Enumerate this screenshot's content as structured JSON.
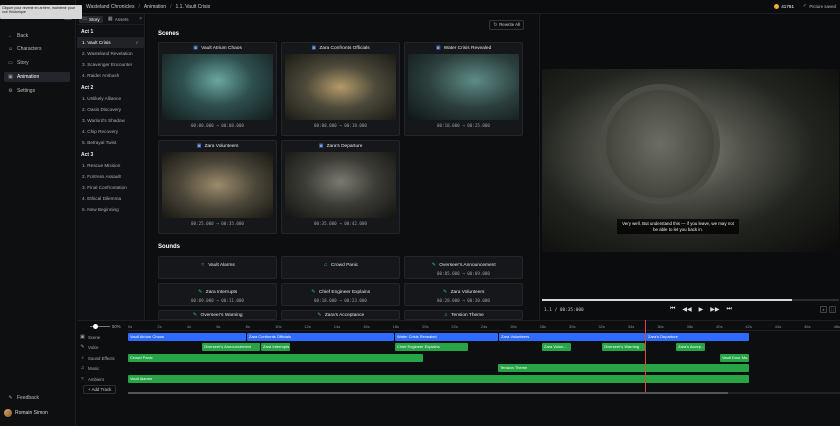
{
  "tooltip": "Cliquer pour revenir en arrière, maintenir pour voir l'historique",
  "nav": {
    "items": [
      {
        "label": "Back",
        "icon": "arrow-left-icon"
      },
      {
        "label": "Characters",
        "icon": "users-icon"
      },
      {
        "label": "Story",
        "icon": "book-icon"
      },
      {
        "label": "Animation",
        "icon": "film-icon"
      },
      {
        "label": "Settings",
        "icon": "gear-icon"
      }
    ],
    "feedback": "Feedback",
    "user": "Romain Simon"
  },
  "breadcrumb": [
    "Wasteland Chronicles",
    "Animation",
    "1.1. Vault Crisis"
  ],
  "credits": "41761",
  "saved": "Picture saved",
  "story_panel": {
    "tabs": [
      "Story",
      "Assets"
    ],
    "acts": [
      {
        "title": "Act 1",
        "scenes": [
          "1. Vault Crisis",
          "2. Wasteland Revelation",
          "3. Scavenger Encounter",
          "4. Raider Ambush"
        ]
      },
      {
        "title": "Act 2",
        "scenes": [
          "1. Unlikely Alliance",
          "2. Oasis Discovery",
          "3. Warlord's Shadow",
          "4. Chip Recovery",
          "5. Betrayal Twist"
        ]
      },
      {
        "title": "Act 3",
        "scenes": [
          "1. Rescue Mission",
          "2. Fortress Assault",
          "3. Final Confrontation",
          "4. Ethical Dilemma",
          "5. New Beginning"
        ]
      }
    ]
  },
  "main": {
    "rewrite_label": "Rewrite All",
    "scenes_title": "Scenes",
    "sounds_title": "Sounds",
    "scenes": [
      {
        "title": "Vault Atrium Chaos",
        "time": "00:00.000 → 00:08.000"
      },
      {
        "title": "Zara Confronts Officials",
        "time": "00:08.000 → 00:18.000"
      },
      {
        "title": "Water Crisis Revealed",
        "time": "00:18.000 → 00:25.000"
      },
      {
        "title": "Zara Volunteers",
        "time": "00:25.000 → 00:35.000"
      },
      {
        "title": "Zara's Departure",
        "time": "00:35.000 → 00:42.000"
      }
    ],
    "sounds": [
      {
        "title": "Vault Alarms",
        "time": ""
      },
      {
        "title": "Crowd Panic",
        "time": ""
      },
      {
        "title": "Overseer's Announcement",
        "time": "00:05.000 → 00:09.000"
      },
      {
        "title": "Zara Interrupts",
        "time": "00:09.000 → 00:11.000"
      },
      {
        "title": "Chief Engineer Explains",
        "time": "00:18.000 → 00:23.000"
      },
      {
        "title": "Zara Volunteers",
        "time": "00:28.000 → 00:30.000"
      },
      {
        "title": "Overseer's Warning",
        "time": ""
      },
      {
        "title": "Zara's Acceptance",
        "time": ""
      },
      {
        "title": "Tension Theme",
        "time": ""
      }
    ]
  },
  "preview": {
    "subtitle": "Very well. But understand this — if you leave, we may not be able to let you back in.",
    "timecode": "1.1 / 00:35:000"
  },
  "timeline": {
    "zoom": "50%",
    "ticks": [
      "0s",
      "2s",
      "4s",
      "6s",
      "8s",
      "10s",
      "12s",
      "14s",
      "16s",
      "18s",
      "20s",
      "22s",
      "24s",
      "26s",
      "28s",
      "30s",
      "32s",
      "34s",
      "36s",
      "38s",
      "40s",
      "42s",
      "44s",
      "46s",
      "48s"
    ],
    "tracks": [
      "Scene",
      "Voice",
      "Sound Effects",
      "Music",
      "Ambient"
    ],
    "add_track": "Add Track",
    "clips": {
      "scene": [
        "Vault Atrium Chaos",
        "Zara Confronts Officials",
        "Water Crisis Revealed",
        "Zara Volunteers",
        "Zara's Departure"
      ],
      "voice": [
        "Overseer's Announcement",
        "Zara Interrupts",
        "Chief Engineer Explains",
        "Zara Volun...",
        "Overseer's Warning",
        "Zara's Accep..."
      ],
      "sfx": [
        "Crowd Panic",
        "Vault Door Mo..."
      ],
      "music": [
        "Tension Theme"
      ],
      "ambient": [
        "Vault Alarms"
      ]
    }
  }
}
